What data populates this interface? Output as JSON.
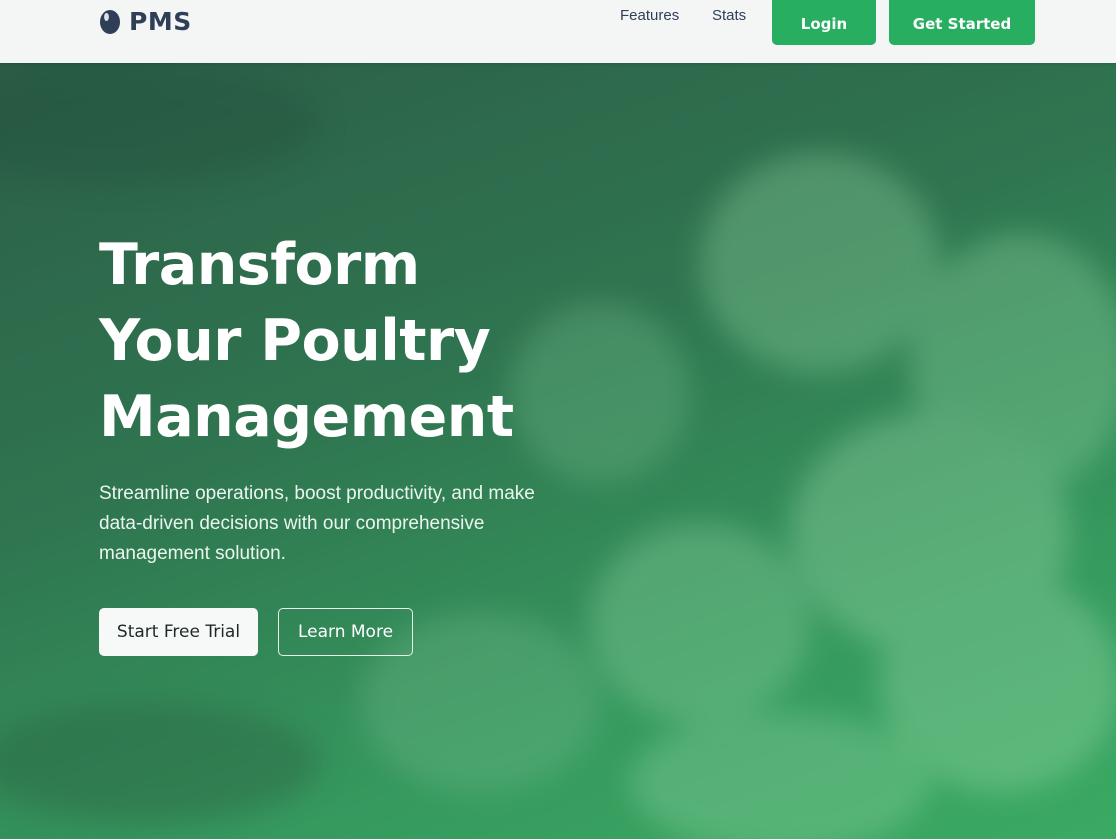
{
  "brand": {
    "name": "PMS",
    "icon": "egg-icon"
  },
  "nav": {
    "links": [
      {
        "label": "Features"
      },
      {
        "label": "Stats"
      }
    ],
    "login_label": "Login",
    "get_started_label": "Get Started"
  },
  "hero": {
    "title_lines": [
      "Transform",
      "Your Poultry",
      "Management"
    ],
    "subtitle": "Streamline operations, boost productivity, and make data-driven decisions with our comprehensive management solution.",
    "primary_cta": "Start Free Trial",
    "secondary_cta": "Learn More"
  },
  "colors": {
    "accent": "#27ae60",
    "brand_text": "#2e3f57",
    "navbar_bg": "#f4f6f5",
    "hero_overlay": "#2f7a52"
  }
}
